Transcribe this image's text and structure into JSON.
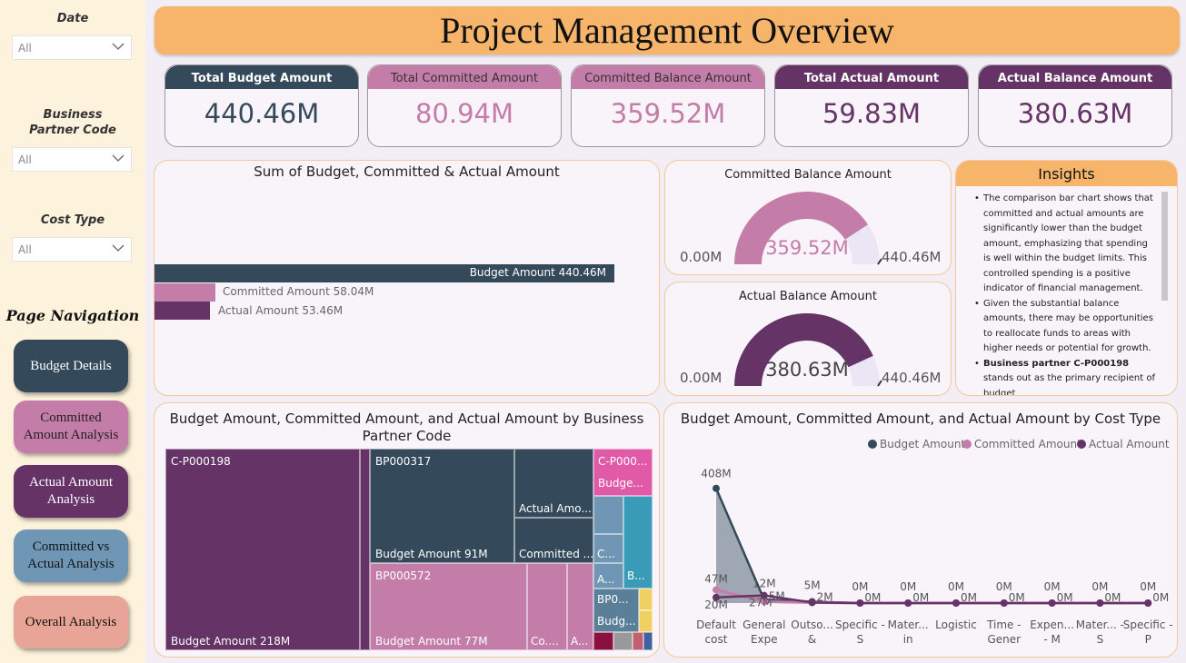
{
  "filters": {
    "date": {
      "title": "Date",
      "value": "All"
    },
    "partner": {
      "title": "Business Partner Code",
      "value": "All"
    },
    "cost": {
      "title": "Cost Type",
      "value": "All"
    }
  },
  "nav": {
    "title": "Page Navigation",
    "buttons": [
      "Budget Details",
      "Committed Amount Analysis",
      "Actual Amount Analysis",
      "Committed vs Actual Analysis",
      "Overall Analysis"
    ]
  },
  "header": {
    "title": "Project Management Overview"
  },
  "kpis": [
    {
      "label": "Total Budget Amount",
      "value": "440.46M"
    },
    {
      "label": "Total Committed Amount",
      "value": "80.94M"
    },
    {
      "label": "Committed Balance Amount",
      "value": "359.52M"
    },
    {
      "label": "Total Actual Amount",
      "value": "59.83M"
    },
    {
      "label": "Actual Balance Amount",
      "value": "380.63M"
    }
  ],
  "sum_chart": {
    "title": "Sum of Budget, Committed & Actual Amount",
    "labels": [
      "Budget Amount 440.46M",
      "Committed Amount 58.04M",
      "Actual Amount 53.46M"
    ]
  },
  "gauges": [
    {
      "title": "Committed Balance Amount",
      "value": "359.52M",
      "min": "0.00M",
      "max": "440.46M",
      "fraction": 0.816
    },
    {
      "title": "Actual Balance Amount",
      "value": "380.63M",
      "min": "0.00M",
      "max": "440.46M",
      "fraction": 0.864
    }
  ],
  "insights": {
    "title": "Insights",
    "items": [
      "The comparison bar chart shows that committed and actual amounts are significantly lower than the budget amount, emphasizing that spending is well within the budget limits. This controlled spending is a positive indicator of financial management.",
      "Given the substantial balance amounts, there may be opportunities to reallocate funds to areas with higher needs or potential for growth."
    ],
    "bold_lead": "Business partner C-P000198",
    "bold_rest": " stands out as the primary recipient of budget"
  },
  "treemap": {
    "title": "Budget Amount, Committed Amount, and Actual Amount by Business Partner Code",
    "labels": {
      "cp198": "C-P000198",
      "cp198_budget": "Budget Amount 218M",
      "bp317": "BP000317",
      "bp317_budget": "Budget Amount 91M",
      "bp317_actual": "Actual Amo...",
      "bp317_committed": "Committed ...",
      "bp572": "BP000572",
      "bp572_budget": "Budget Amount 77M",
      "bp572_co": "Co....",
      "bp572_a": "A...",
      "cp0": "C-P000...",
      "cp0_budget": "Budge...",
      "c_small": "C...",
      "a_small": "A...",
      "b_small": "B...",
      "bp0": "BP0...",
      "bp0_budget": "Budg..."
    }
  },
  "chart_data": {
    "type": "line",
    "title": "Budget Amount, Committed Amount, and Actual Amount by Cost Type",
    "categories": [
      "Default cost",
      "General Expe",
      "Outso... &",
      "Specific - S",
      "Mater... in",
      "Logistic",
      "Time - Gener",
      "Expen... - M",
      "Mater... - S",
      "Specific - P"
    ],
    "series": [
      {
        "name": "Budget Amount",
        "color": "#34495a",
        "values": [
          408,
          12,
          5,
          0,
          0,
          0,
          0,
          0,
          0,
          0
        ],
        "labels": [
          "408M",
          "12M",
          "5M",
          "0M",
          "0M",
          "0M",
          "0M",
          "0M",
          "0M",
          "0M"
        ]
      },
      {
        "name": "Committed Amount",
        "color": "#c47ca8",
        "values": [
          47,
          5,
          2,
          0,
          0,
          0,
          0,
          0,
          0,
          0
        ],
        "labels": [
          "47M",
          "5M",
          "2M",
          "0M",
          "0M",
          "0M",
          "0M",
          "0M",
          "0M",
          "0M"
        ]
      },
      {
        "name": "Actual Amount",
        "color": "#663366",
        "values": [
          20,
          27,
          2,
          0,
          0,
          0,
          0,
          0,
          0,
          0
        ],
        "labels": [
          "20M",
          "27M",
          "",
          "",
          "",
          "",
          "",
          "",
          "",
          ""
        ]
      }
    ],
    "ylim": [
      0,
      420
    ]
  }
}
